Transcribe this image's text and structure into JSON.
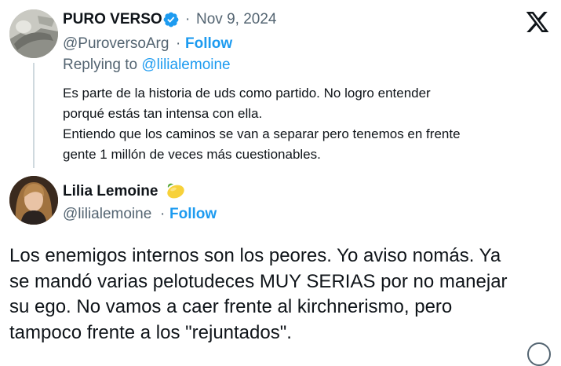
{
  "reply_tweet": {
    "author_name": "PURO VERSO",
    "separator": "·",
    "date": "Nov 9, 2024",
    "handle": "@PuroversoArg",
    "follow_label": "Follow",
    "replying_prefix": "Replying to",
    "replying_handle": "@lilialemoine",
    "text_lines": [
      "Es parte de la historia de uds como partido. No logro entender",
      "porqué estás tan intensa con ella.",
      "Entiendo que los caminos se van a separar pero tenemos en frente",
      "gente 1 millón de veces más cuestionables."
    ],
    "verified": true
  },
  "main_tweet": {
    "author_name": "Lilia Lemoine",
    "name_emoji": "lemon-icon",
    "handle": "@lilialemoine",
    "separator": "·",
    "follow_label": "Follow",
    "text_lines": [
      "Los enemigos internos son los peores. Yo aviso nomás. Ya",
      "se mandó varias pelotudeces MUY SERIAS por no manejar",
      "su ego. No vamos a caer frente al kirchnerismo, pero",
      "tampoco frente a los \"rejuntados\"."
    ]
  },
  "colors": {
    "accent": "#1d9bf0",
    "text": "#0f1419",
    "muted": "#536471"
  },
  "icons": {
    "brand": "x-logo-icon",
    "verified": "verified-badge-icon"
  }
}
